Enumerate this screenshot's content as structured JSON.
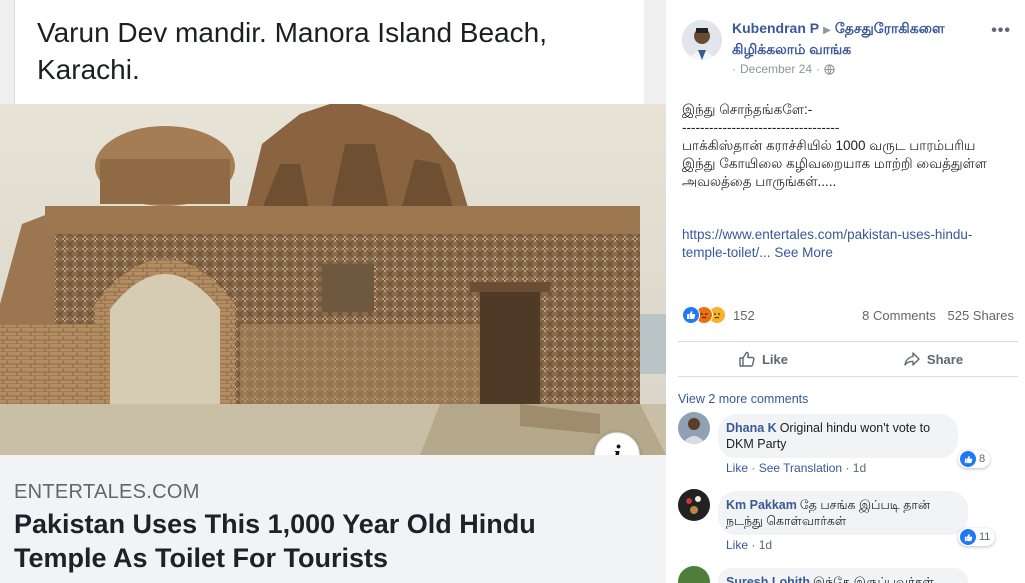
{
  "left": {
    "caption": "Varun Dev mandir. Manora Island Beach, Karachi.",
    "link_domain": "ENTERTALES.COM",
    "link_title": "Pakistan Uses This 1,000 Year Old Hindu Temple As Toilet For Tourists",
    "info_icon": "i"
  },
  "post": {
    "author": "Kubendran P",
    "arrow_icon": "▶",
    "group": "தேசதுரோகிகளை கிழிக்கலாம் வாங்க",
    "date": "December 24",
    "date_sep": "·",
    "more_icon": "•••",
    "text_line1": "இந்து சொந்தங்களே:-",
    "text_line2": "-----------------------------------",
    "text_line3": "பாக்கிஸ்தான் கராச்சியில் 1000 வருட பாரம்பரிய இந்து கோயிலை கழிவறையாக மாற்றி வைத்துள்ள அவலத்தை பாருங்கள்.....",
    "link_text": "https://www.entertales.com/pakistan-uses-hindu-temple-toilet/...",
    "see_more": "See More",
    "reaction_count": "152",
    "comments_count": "8 Comments",
    "shares_count": "525 Shares",
    "like_label": "Like",
    "share_label": "Share"
  },
  "comments": {
    "view_more": "View 2 more comments",
    "items": [
      {
        "name": "Dhana K",
        "text": "Original hindu won't vote to DKM Party",
        "like": "Like",
        "see_translation": "See Translation",
        "sep": "·",
        "time": "1d",
        "reactions": "8"
      },
      {
        "name": "Km Pakkam",
        "text": "தே பசங்க இப்படி தான் நடந்து கொள்வார்கள்",
        "like": "Like",
        "sep": "·",
        "time": "1d",
        "reactions": "11"
      },
      {
        "name": "Suresh Lohith",
        "text": "இந்தே இருப்பவர்கள்"
      }
    ]
  },
  "colors": {
    "link_blue": "#385898",
    "like_blue": "#2078f4",
    "meta_gray": "#606770"
  }
}
